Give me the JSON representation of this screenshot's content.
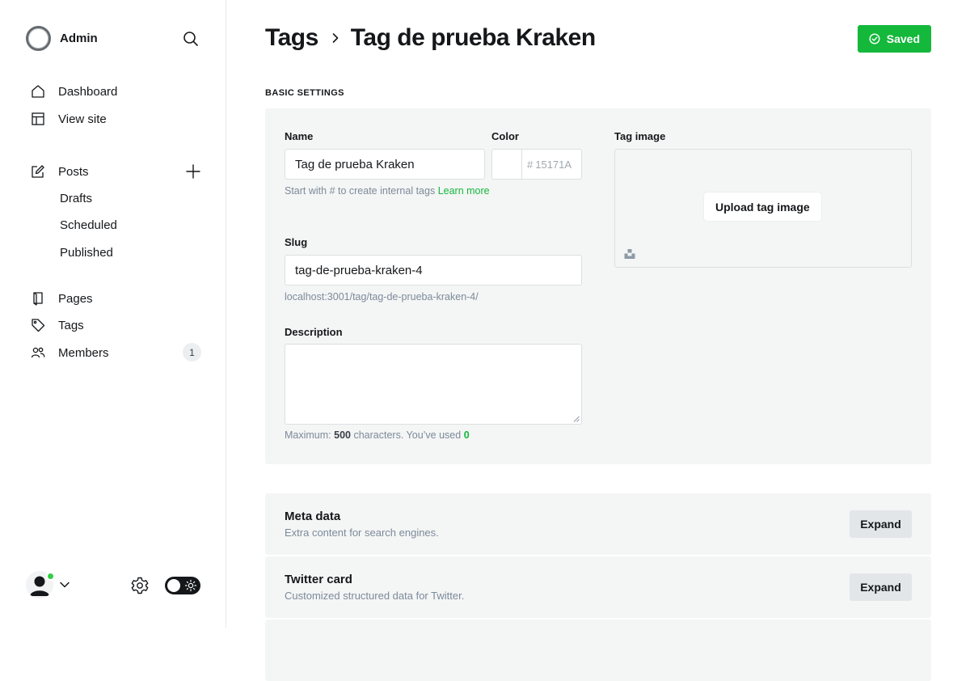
{
  "sidebar": {
    "brand": "Admin",
    "nav": {
      "dashboard": "Dashboard",
      "view_site": "View site",
      "posts": "Posts",
      "drafts": "Drafts",
      "scheduled": "Scheduled",
      "published": "Published",
      "pages": "Pages",
      "tags": "Tags",
      "members": "Members",
      "members_count": "1"
    }
  },
  "header": {
    "breadcrumb_parent": "Tags",
    "breadcrumb_current": "Tag de prueba Kraken",
    "saved_label": "Saved"
  },
  "basic_settings": {
    "section_label": "BASIC SETTINGS",
    "name": {
      "label": "Name",
      "value": "Tag de prueba Kraken",
      "hint": "Start with # to create internal tags",
      "hint_link": "Learn more"
    },
    "color": {
      "label": "Color",
      "hash": "#",
      "placeholder": "15171A"
    },
    "slug": {
      "label": "Slug",
      "value": "tag-de-prueba-kraken-4",
      "url_preview": "localhost:3001/tag/tag-de-prueba-kraken-4/"
    },
    "description": {
      "label": "Description",
      "value": "",
      "hint_prefix": "Maximum:",
      "max_chars": "500",
      "hint_middle": "characters. You’ve used",
      "used_chars": "0"
    },
    "tag_image": {
      "label": "Tag image",
      "upload_label": "Upload tag image"
    }
  },
  "expanders": [
    {
      "title": "Meta data",
      "subtitle": "Extra content for search engines.",
      "button": "Expand"
    },
    {
      "title": "Twitter card",
      "subtitle": "Customized structured data for Twitter.",
      "button": "Expand"
    }
  ],
  "colors": {
    "accent_green": "#14b83b",
    "panel_bg": "#f4f5f5",
    "status_online": "#30cf43"
  },
  "icons": {
    "search": "search-icon",
    "dashboard": "home-icon",
    "view_site": "layout-icon",
    "posts": "pencil-icon",
    "pages": "page-icon",
    "tags": "tag-icon",
    "members": "users-icon",
    "settings": "gear-icon",
    "saved": "check-circle-icon"
  }
}
